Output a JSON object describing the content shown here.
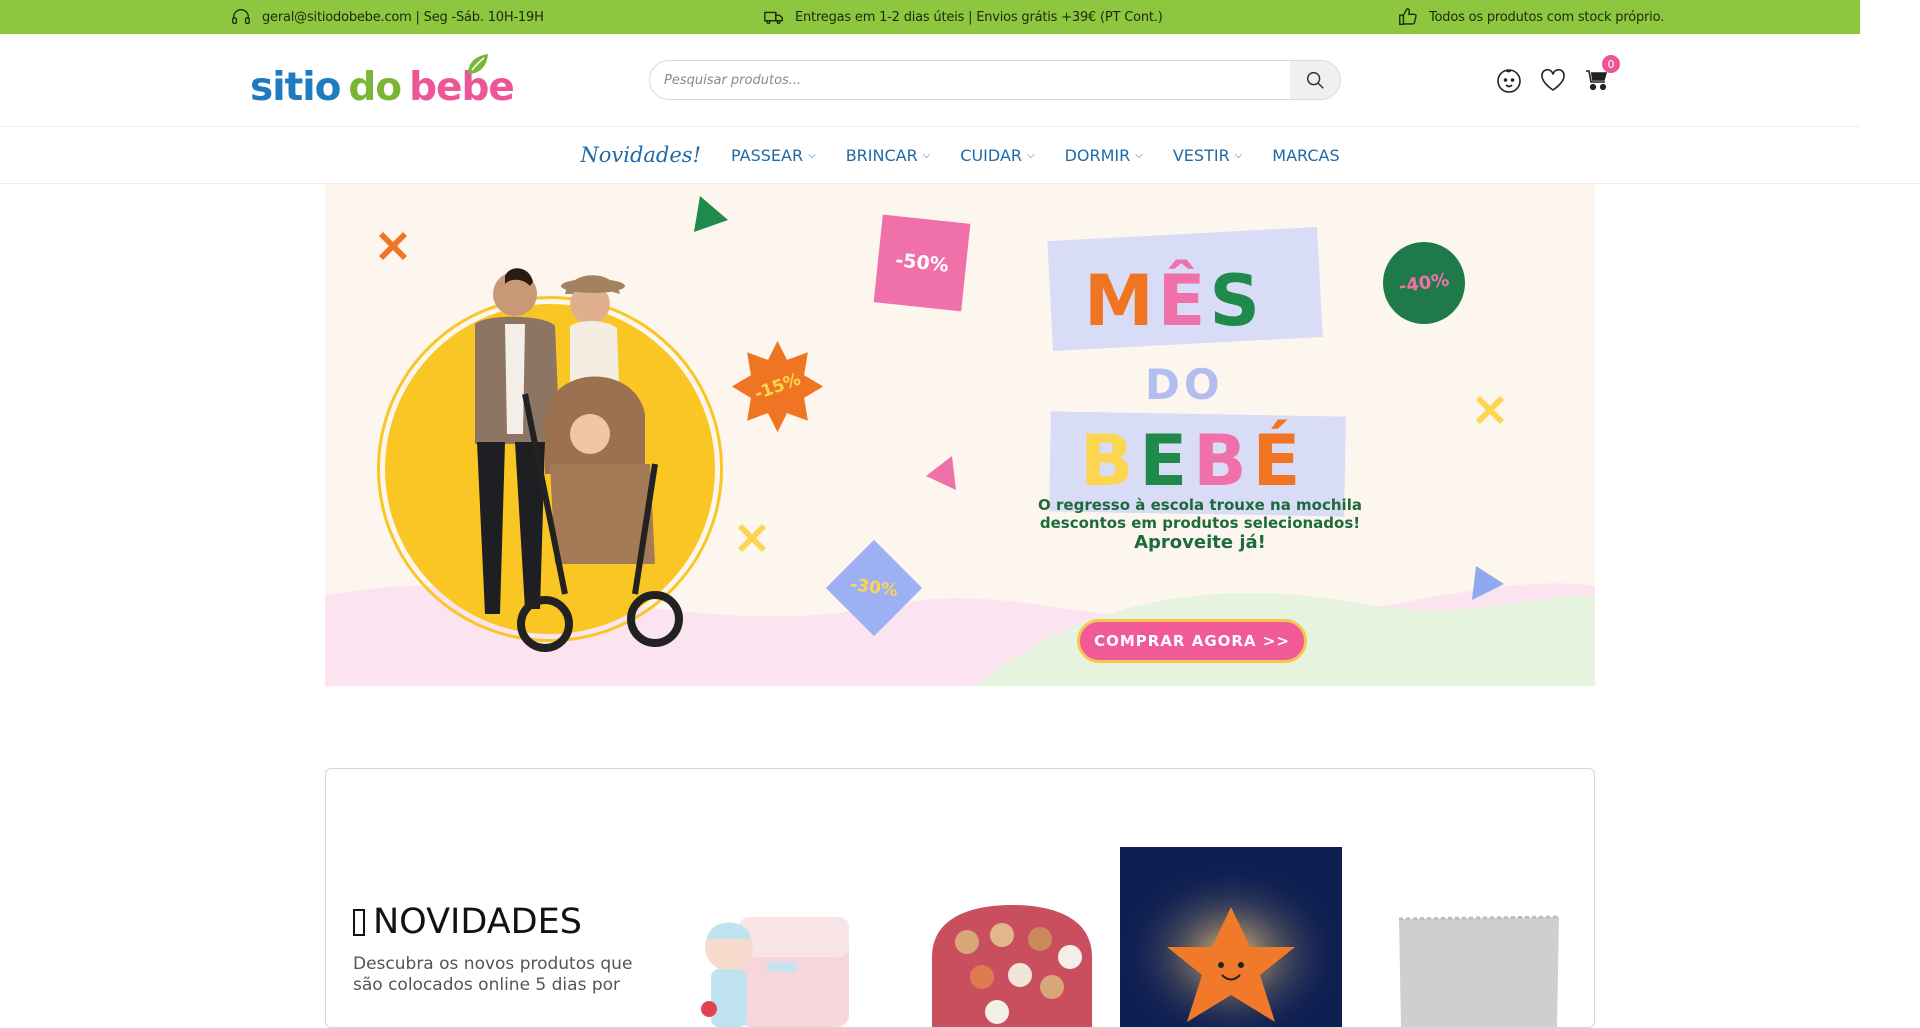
{
  "topbar": {
    "contact": "geral@sitiodobebe.com | Seg -Sáb. 10H-19H",
    "shipping": "Entregas em 1-2 dias úteis | Envios grátis +39€ (PT Cont.)",
    "stock": "Todos os produtos com stock próprio."
  },
  "header": {
    "logo": {
      "part1": "sitio",
      "part2": "do",
      "part3": "bebe"
    },
    "search_placeholder": "Pesquisar produtos...",
    "cart_count": "0"
  },
  "nav": {
    "items": [
      {
        "label": "Novidades!",
        "dropdown": false
      },
      {
        "label": "PASSEAR",
        "dropdown": true
      },
      {
        "label": "BRINCAR",
        "dropdown": true
      },
      {
        "label": "CUIDAR",
        "dropdown": true
      },
      {
        "label": "DORMIR",
        "dropdown": true
      },
      {
        "label": "VESTIR",
        "dropdown": true
      },
      {
        "label": "MARCAS",
        "dropdown": false
      }
    ]
  },
  "hero": {
    "title_line1": "MÊS",
    "title_line2": "DO",
    "title_line3": "BEBÉ",
    "copy_line1": "O regresso à escola trouxe na mochila",
    "copy_line2": "descontos em produtos selecionados!",
    "copy_line3": "Aproveite já!",
    "cta": "COMPRAR AGORA >>",
    "stickers": {
      "s50": "-50%",
      "s15": "-15%",
      "s40": "-40%",
      "s30": "-30%"
    }
  },
  "novidades": {
    "title": "NOVIDADES",
    "description": "Descubra os novos produtos que são colocados online 5 dias por"
  },
  "colors": {
    "topbar": "#8dc63f",
    "brand_blue": "#1f7bbf",
    "brand_green": "#7bb535",
    "brand_pink": "#ec5596",
    "nav_text": "#1e6aa8"
  }
}
